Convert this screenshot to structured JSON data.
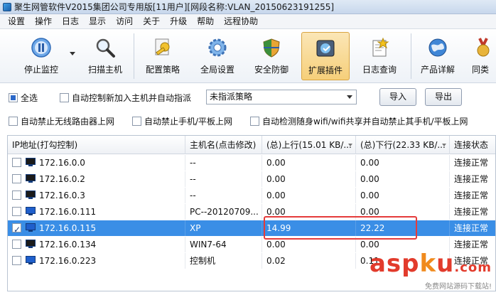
{
  "window": {
    "title": "聚生网管软件V2015集团公司专用版[11用户][网段名称:VLAN_20150623191255]"
  },
  "menu": [
    "设置",
    "操作",
    "日志",
    "显示",
    "访问",
    "关于",
    "升级",
    "帮助",
    "远程协助"
  ],
  "toolbar": {
    "buttons": [
      {
        "label": "停止监控",
        "icon": "pause-icon"
      },
      {
        "label": "扫描主机",
        "icon": "magnifier-icon"
      },
      {
        "label": "配置策略",
        "icon": "key-icon"
      },
      {
        "label": "全局设置",
        "icon": "gear-icon"
      },
      {
        "label": "安全防御",
        "icon": "shield-icon"
      },
      {
        "label": "扩展插件",
        "icon": "plugin-icon"
      },
      {
        "label": "日志查询",
        "icon": "log-icon"
      },
      {
        "label": "产品详解",
        "icon": "globe-icon"
      },
      {
        "label": "同类",
        "icon": "medal-icon"
      }
    ]
  },
  "options": {
    "select_all": "全选",
    "auto_control": "自动控制新加入主机并自动指派",
    "policy_selected": "未指派策略",
    "import_label": "导入",
    "export_label": "导出",
    "row2": [
      "自动禁止无线路由器上网",
      "自动禁止手机/平板上网",
      "自动检测随身wifi/wifi共享并自动禁止其手机/平板上网"
    ]
  },
  "table": {
    "columns": [
      "IP地址(打勾控制)",
      "主机名(点击修改)",
      "(总)上行(15.01 KB/...",
      "(总)下行(22.33 KB/...",
      "连接状态"
    ],
    "rows": [
      {
        "ip": "172.16.0.0",
        "host": "--",
        "up": "0.00",
        "down": "0.00",
        "status": "连接正常",
        "checked": false,
        "selected": false,
        "screen": "dark"
      },
      {
        "ip": "172.16.0.2",
        "host": "--",
        "up": "0.00",
        "down": "0.00",
        "status": "连接正常",
        "checked": false,
        "selected": false,
        "screen": "dark"
      },
      {
        "ip": "172.16.0.3",
        "host": "--",
        "up": "0.00",
        "down": "0.00",
        "status": "连接正常",
        "checked": false,
        "selected": false,
        "screen": "dark"
      },
      {
        "ip": "172.16.0.111",
        "host": "PC--20120709...",
        "up": "0.00",
        "down": "0.00",
        "status": "连接正常",
        "checked": false,
        "selected": false,
        "screen": "blue"
      },
      {
        "ip": "172.16.0.115",
        "host": "XP",
        "up": "14.99",
        "down": "22.22",
        "status": "连接正常",
        "checked": true,
        "selected": true,
        "screen": "blue"
      },
      {
        "ip": "172.16.0.134",
        "host": "WIN7-64",
        "up": "0.00",
        "down": "0.00",
        "status": "连接正常",
        "checked": false,
        "selected": false,
        "screen": "dark"
      },
      {
        "ip": "172.16.0.223",
        "host": "控制机",
        "up": "0.02",
        "down": "0.11",
        "status": "连接正常",
        "checked": false,
        "selected": false,
        "screen": "blue"
      }
    ]
  },
  "watermark": {
    "main_a": "asp",
    "main_dot": "k",
    "main_b": "u",
    "tld": ".com",
    "sub": "免费网站源码下载站!"
  },
  "colors": {
    "selection": "#3a8ee6",
    "highlight_border": "#e53b3b",
    "watermark": "#e23b2c"
  }
}
